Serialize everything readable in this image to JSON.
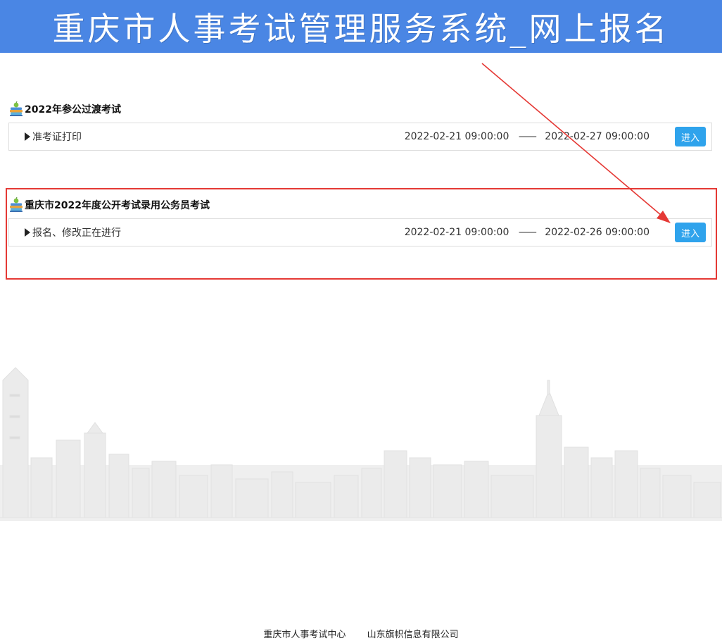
{
  "header": {
    "title": "重庆市人事考试管理服务系统_网上报名"
  },
  "sections": [
    {
      "title": "2022年参公过渡考试",
      "row": {
        "label": "准考证打印",
        "start": "2022-02-21 09:00:00",
        "dash": "——",
        "end": "2022-02-27 09:00:00",
        "button": "进入"
      }
    },
    {
      "title": "重庆市2022年度公开考试录用公务员考试",
      "row": {
        "label": "报名、修改正在进行",
        "start": "2022-02-21 09:00:00",
        "dash": "——",
        "end": "2022-02-26 09:00:00",
        "button": "进入"
      }
    }
  ],
  "footer": {
    "org": "重庆市人事考试中心",
    "company": "山东旗帜信息有限公司"
  },
  "colors": {
    "banner": "#4a86e4",
    "button": "#2fa3ec",
    "highlight": "#e53935"
  }
}
